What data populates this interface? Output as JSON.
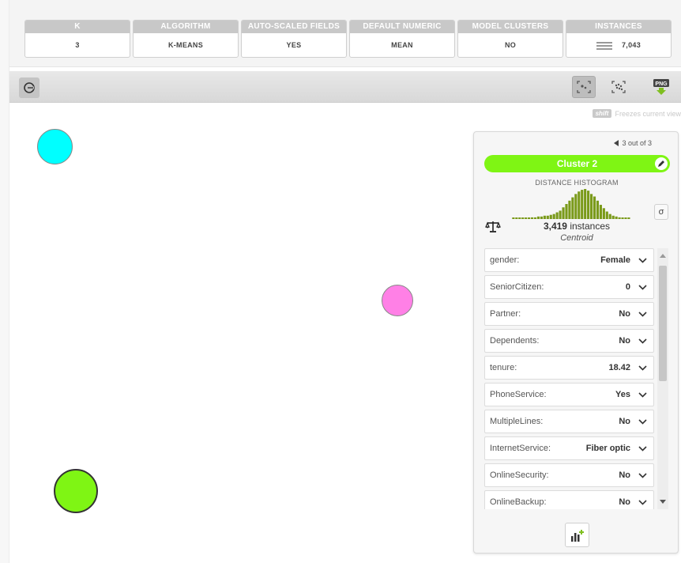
{
  "summary": {
    "cards": [
      {
        "header": "K",
        "value": "3"
      },
      {
        "header": "ALGORITHM",
        "value": "K-MEANS"
      },
      {
        "header": "AUTO-SCALED FIELDS",
        "value": "YES"
      },
      {
        "header": "DEFAULT NUMERIC",
        "value": "MEAN"
      },
      {
        "header": "MODEL CLUSTERS",
        "value": "NO"
      },
      {
        "header": "INSTANCES",
        "value": "7,043"
      }
    ]
  },
  "toolbar": {
    "freeze_key": "shift",
    "freeze_text": "Freezes current view",
    "png_label": "PNG"
  },
  "clusters": [
    {
      "color": "#00ffff"
    },
    {
      "color": "#ff80e6"
    },
    {
      "color": "#7ff514"
    }
  ],
  "panel": {
    "pager": "3 out of 3",
    "cluster_name": "Cluster 2",
    "cluster_color": "#7ff514",
    "histogram_label": "DISTANCE HISTOGRAM",
    "histogram_color": "#7a9a1a",
    "histogram": [
      1,
      1,
      1,
      1,
      1,
      1,
      2,
      2,
      3,
      3,
      4,
      4,
      5,
      6,
      8,
      10,
      14,
      18,
      22,
      26,
      30,
      33,
      35,
      36,
      34,
      30,
      27,
      22,
      17,
      13,
      9,
      6,
      4,
      3,
      2,
      1,
      1,
      1
    ],
    "sigma": "σ",
    "instances_count": "3,419",
    "instances_word": "instances",
    "centroid_label": "Centroid",
    "fields": [
      {
        "name": "gender:",
        "value": "Female"
      },
      {
        "name": "SeniorCitizen:",
        "value": "0"
      },
      {
        "name": "Partner:",
        "value": "No"
      },
      {
        "name": "Dependents:",
        "value": "No"
      },
      {
        "name": "tenure:",
        "value": "18.42"
      },
      {
        "name": "PhoneService:",
        "value": "Yes"
      },
      {
        "name": "MultipleLines:",
        "value": "No"
      },
      {
        "name": "InternetService:",
        "value": "Fiber optic"
      },
      {
        "name": "OnlineSecurity:",
        "value": "No"
      },
      {
        "name": "OnlineBackup:",
        "value": "No"
      }
    ]
  }
}
